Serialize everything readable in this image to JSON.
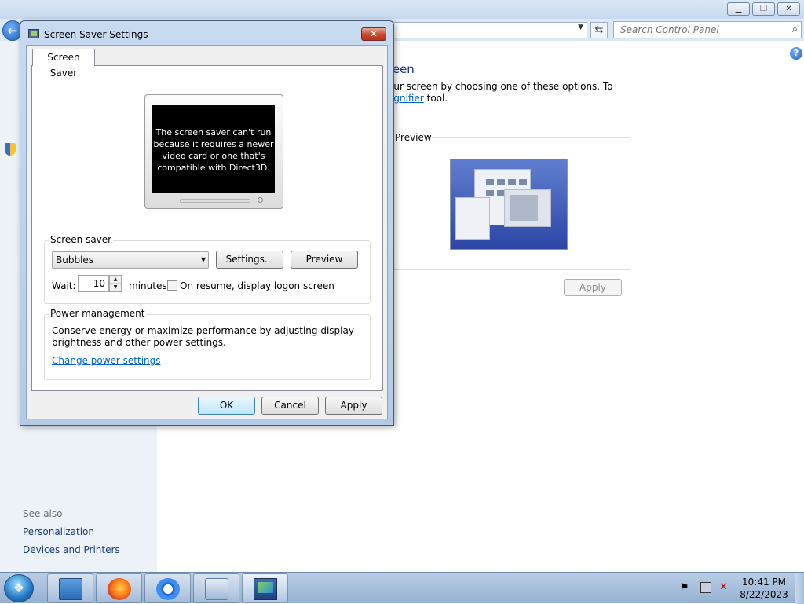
{
  "control_panel": {
    "search_placeholder": "Search Control Panel",
    "heading_fragment": "reen",
    "desc_line1_fragment": "our screen by choosing one of these options. To",
    "desc_link_fragment": "agnifier",
    "desc_line2_suffix": " tool.",
    "preview_label": "Preview",
    "apply_label": "Apply",
    "see_also": "See also",
    "see_also_links": [
      "Personalization",
      "Devices and Printers"
    ]
  },
  "dialog": {
    "title": "Screen Saver Settings",
    "tab_label": "Screen Saver",
    "monitor_message": "The screen saver can't run because it requires a newer video card or one that's compatible with Direct3D.",
    "screen_saver_group": "Screen saver",
    "selected_saver": "Bubbles",
    "settings_label": "Settings...",
    "preview_label": "Preview",
    "wait_label": "Wait:",
    "wait_value": "10",
    "minutes_label": "minutes",
    "logon_label": "On resume, display logon screen",
    "logon_checked": false,
    "power_group": "Power management",
    "power_desc_line1": "Conserve energy or maximize performance by adjusting display",
    "power_desc_line2": "brightness and other power settings.",
    "power_link": "Change power settings",
    "ok_label": "OK",
    "cancel_label": "Cancel",
    "apply_label": "Apply"
  },
  "taskbar": {
    "apps": [
      "windows-explorer-icon",
      "firefox-icon",
      "chrome-icon",
      "control-panel-icon",
      "display-settings-icon"
    ],
    "time": "10:41 PM",
    "date": "8/22/2023"
  }
}
